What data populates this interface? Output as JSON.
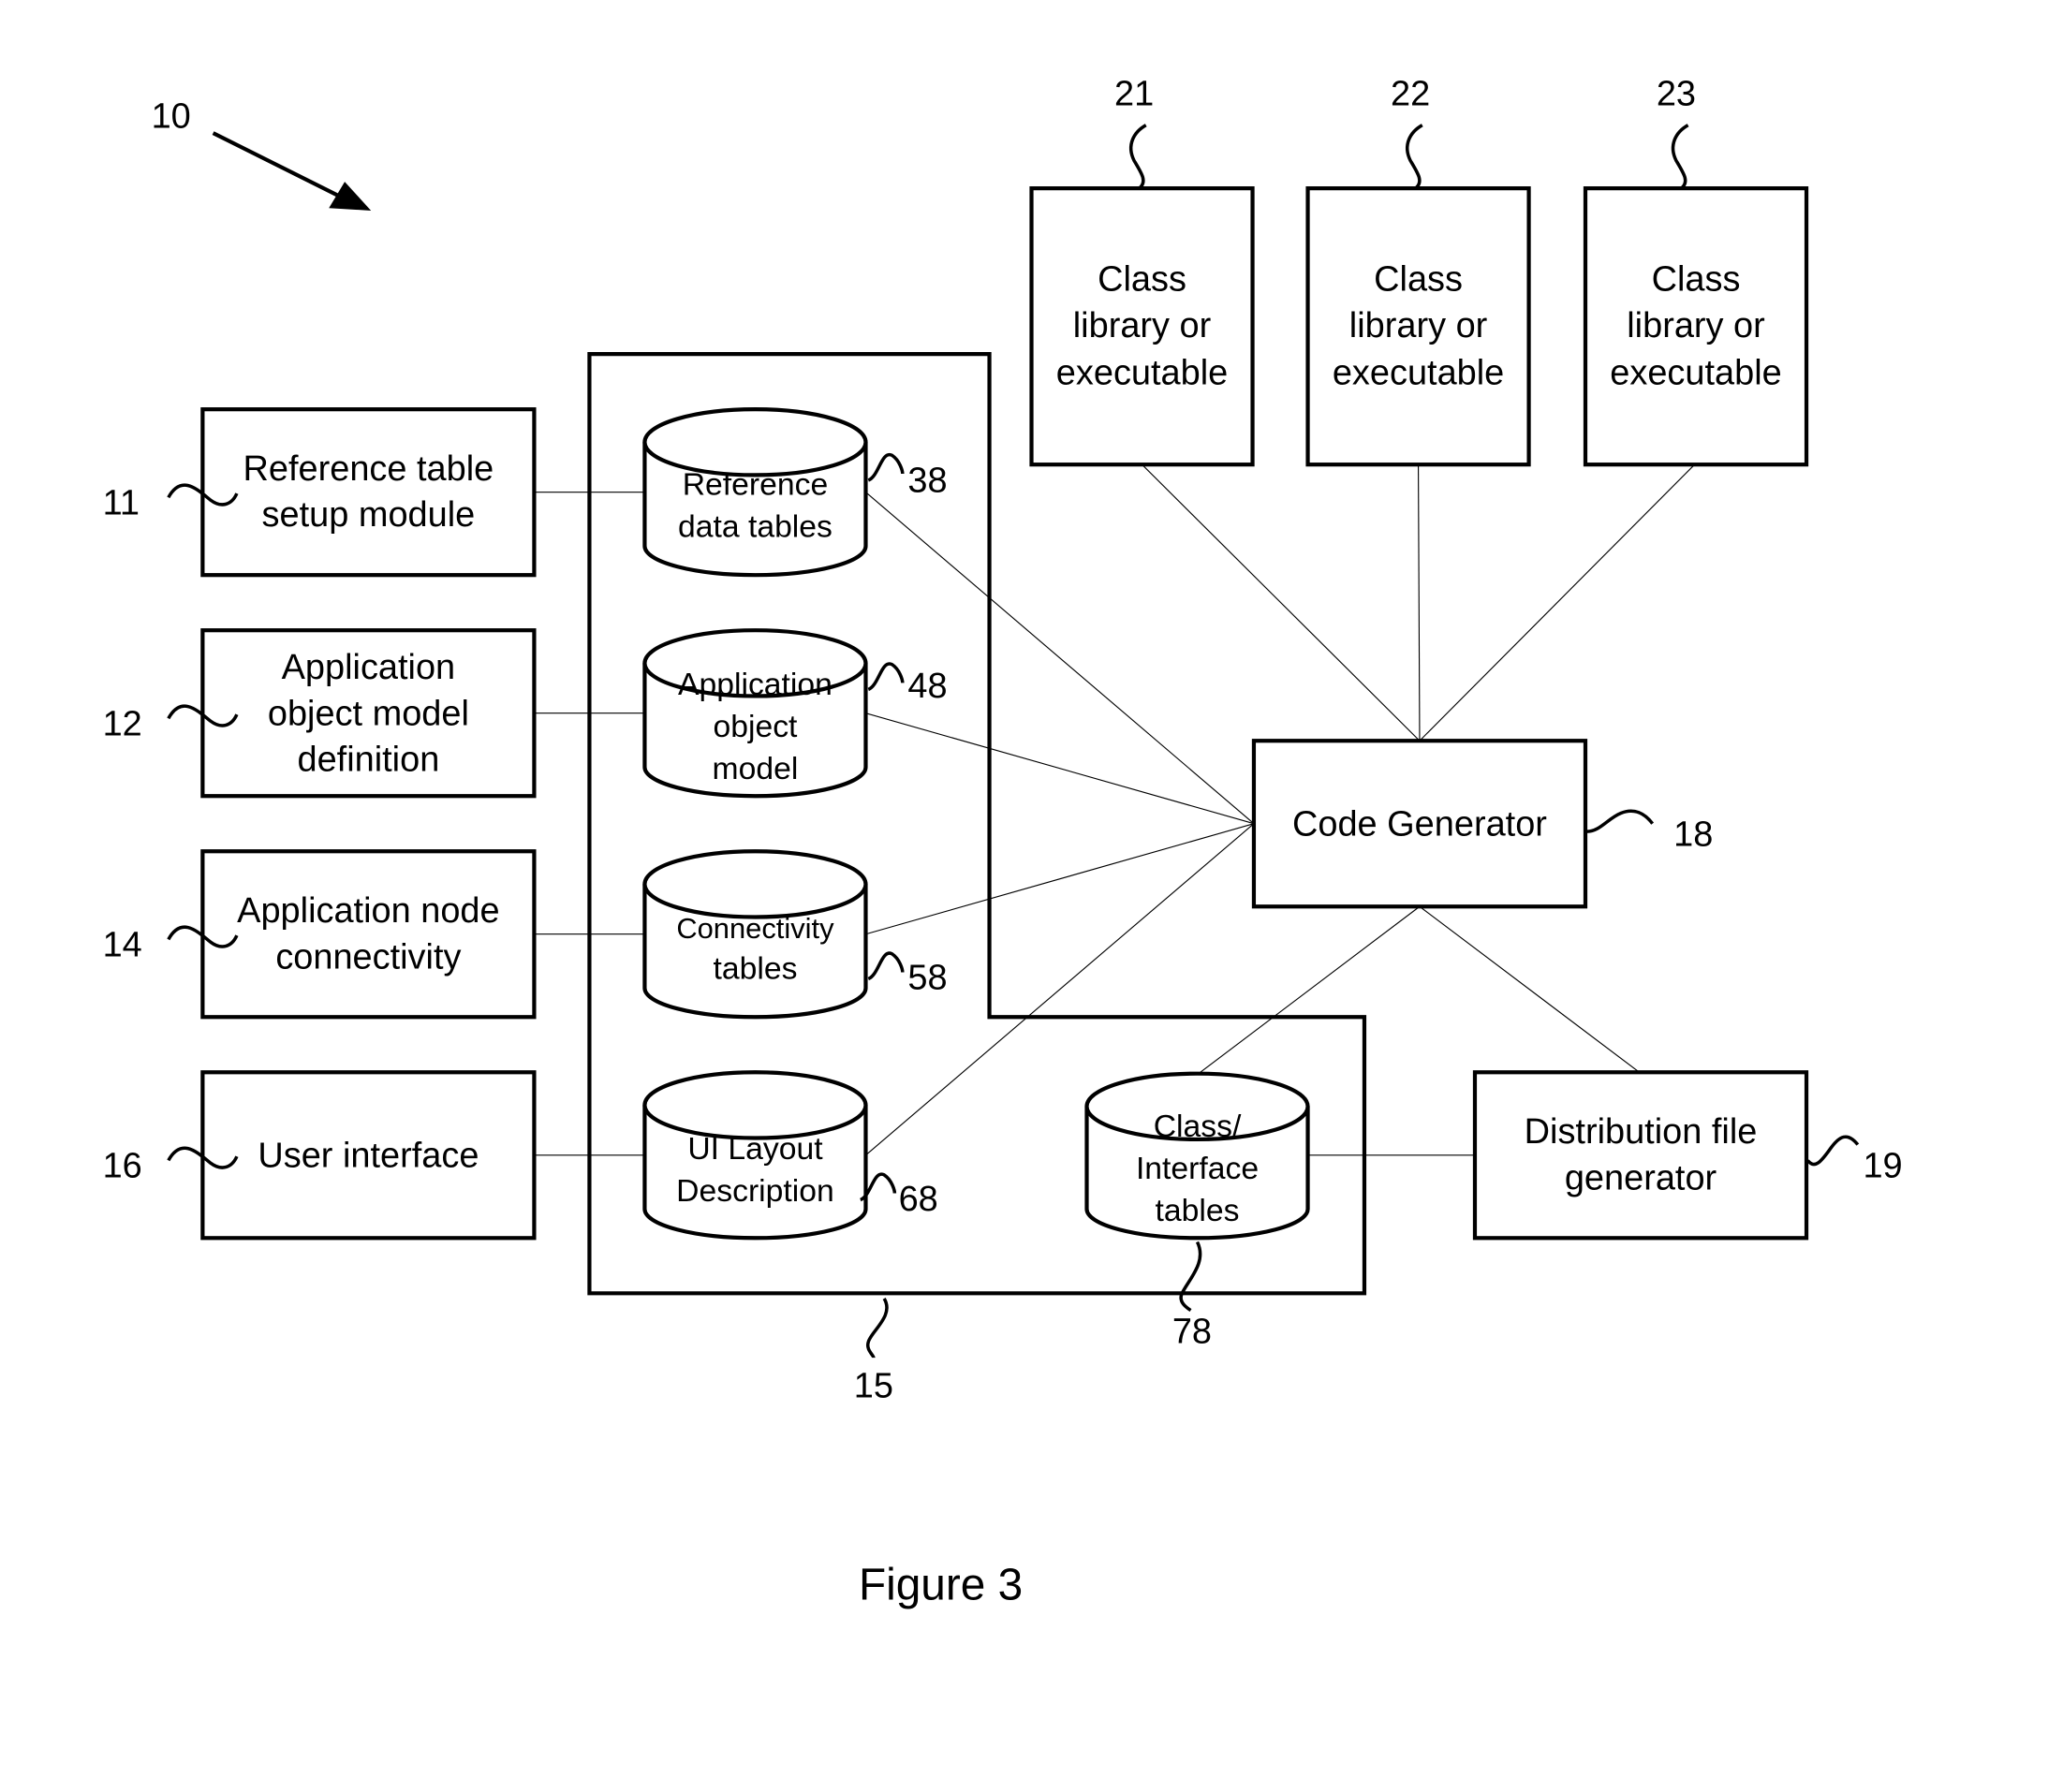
{
  "figure": {
    "caption": "Figure 3",
    "system_ref": "10",
    "container_ref": "15"
  },
  "left_modules": [
    {
      "ref": "11",
      "lines": [
        "Reference table",
        "setup module"
      ]
    },
    {
      "ref": "12",
      "lines": [
        "Application",
        "object model",
        "definition"
      ]
    },
    {
      "ref": "14",
      "lines": [
        "Application node",
        "connectivity"
      ]
    },
    {
      "ref": "16",
      "lines": [
        "User interface"
      ]
    }
  ],
  "databases": [
    {
      "ref": "38",
      "lines": [
        "Reference",
        "data tables"
      ]
    },
    {
      "ref": "48",
      "lines": [
        "Application",
        "object",
        "model"
      ]
    },
    {
      "ref": "58",
      "lines": [
        "Connectivity",
        "tables"
      ]
    },
    {
      "ref": "68",
      "lines": [
        "UI Layout",
        "Description"
      ]
    },
    {
      "ref": "78",
      "lines": [
        "Class/",
        "Interface",
        "tables"
      ]
    }
  ],
  "class_libraries": [
    {
      "ref": "21",
      "lines": [
        "Class",
        "library or",
        "executable"
      ]
    },
    {
      "ref": "22",
      "lines": [
        "Class",
        "library or",
        "executable"
      ]
    },
    {
      "ref": "23",
      "lines": [
        "Class",
        "library or",
        "executable"
      ]
    }
  ],
  "code_generator": {
    "ref": "18",
    "label": "Code Generator"
  },
  "distribution": {
    "ref": "19",
    "lines": [
      "Distribution file",
      "generator"
    ]
  }
}
